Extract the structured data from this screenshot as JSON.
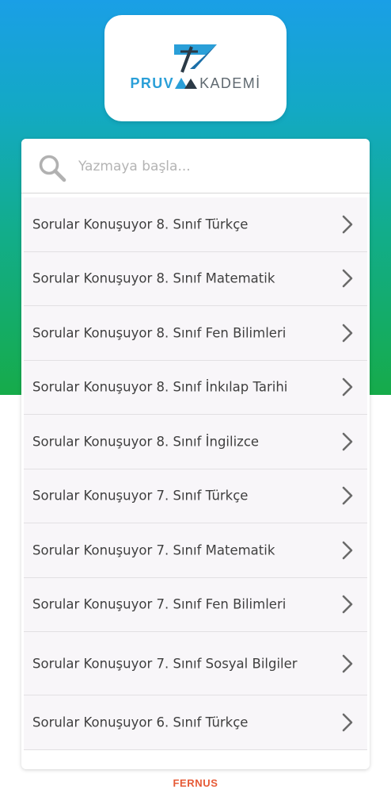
{
  "brand": {
    "logo_part1": "PRUV",
    "logo_part2": "KADEMİ",
    "colors": {
      "blue": "#2a9fd8",
      "gray": "#5f6970"
    }
  },
  "search": {
    "placeholder": "Yazmaya başla..."
  },
  "list": {
    "items": [
      {
        "label": "Sorular Konuşuyor 8. Sınıf Türkçe"
      },
      {
        "label": "Sorular Konuşuyor 8. Sınıf Matematik"
      },
      {
        "label": "Sorular Konuşuyor 8. Sınıf Fen Bilimleri"
      },
      {
        "label": "Sorular Konuşuyor 8. Sınıf İnkılap Tarihi"
      },
      {
        "label": "Sorular Konuşuyor 8. Sınıf İngilizce"
      },
      {
        "label": "Sorular Konuşuyor 7. Sınıf Türkçe"
      },
      {
        "label": "Sorular Konuşuyor 7. Sınıf Matematik"
      },
      {
        "label": "Sorular Konuşuyor 7. Sınıf Fen Bilimleri"
      },
      {
        "label": "Sorular Konuşuyor 7. Sınıf Sosyal Bilgiler"
      },
      {
        "label": "Sorular Konuşuyor 6. Sınıf Türkçe"
      }
    ]
  },
  "icons": {
    "search": "search-icon",
    "item_arrow": "chevron-right-icon"
  },
  "footer": {
    "brand": "FERNUS"
  }
}
